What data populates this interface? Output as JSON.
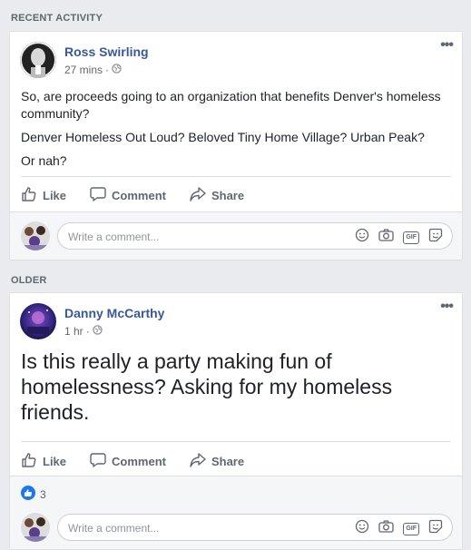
{
  "sections": {
    "recent_label": "RECENT ACTIVITY",
    "older_label": "OLDER"
  },
  "posts": [
    {
      "author": "Ross Swirling",
      "time": "27 mins",
      "separator": "·",
      "paragraphs": [
        "So, are proceeds going to an organization that benefits Denver's homeless community?",
        "Denver Homeless Out Loud? Beloved Tiny Home Village? Urban Peak?",
        "Or nah?"
      ],
      "privacy_icon": "globe-icon"
    },
    {
      "author": "Danny McCarthy",
      "time": "1 hr",
      "separator": "·",
      "text": "Is this really a party making fun of homelessness? Asking for my homeless friends.",
      "likes": "3",
      "privacy_icon": "globe-icon"
    }
  ],
  "actions": {
    "like": "Like",
    "comment": "Comment",
    "share": "Share"
  },
  "comment_box": {
    "placeholder": "Write a comment...",
    "gif_label": "GIF"
  },
  "more_glyph": "•••",
  "colors": {
    "link_blue": "#385898",
    "like_blue": "#1877f2",
    "page_bg": "#e9ebee"
  }
}
